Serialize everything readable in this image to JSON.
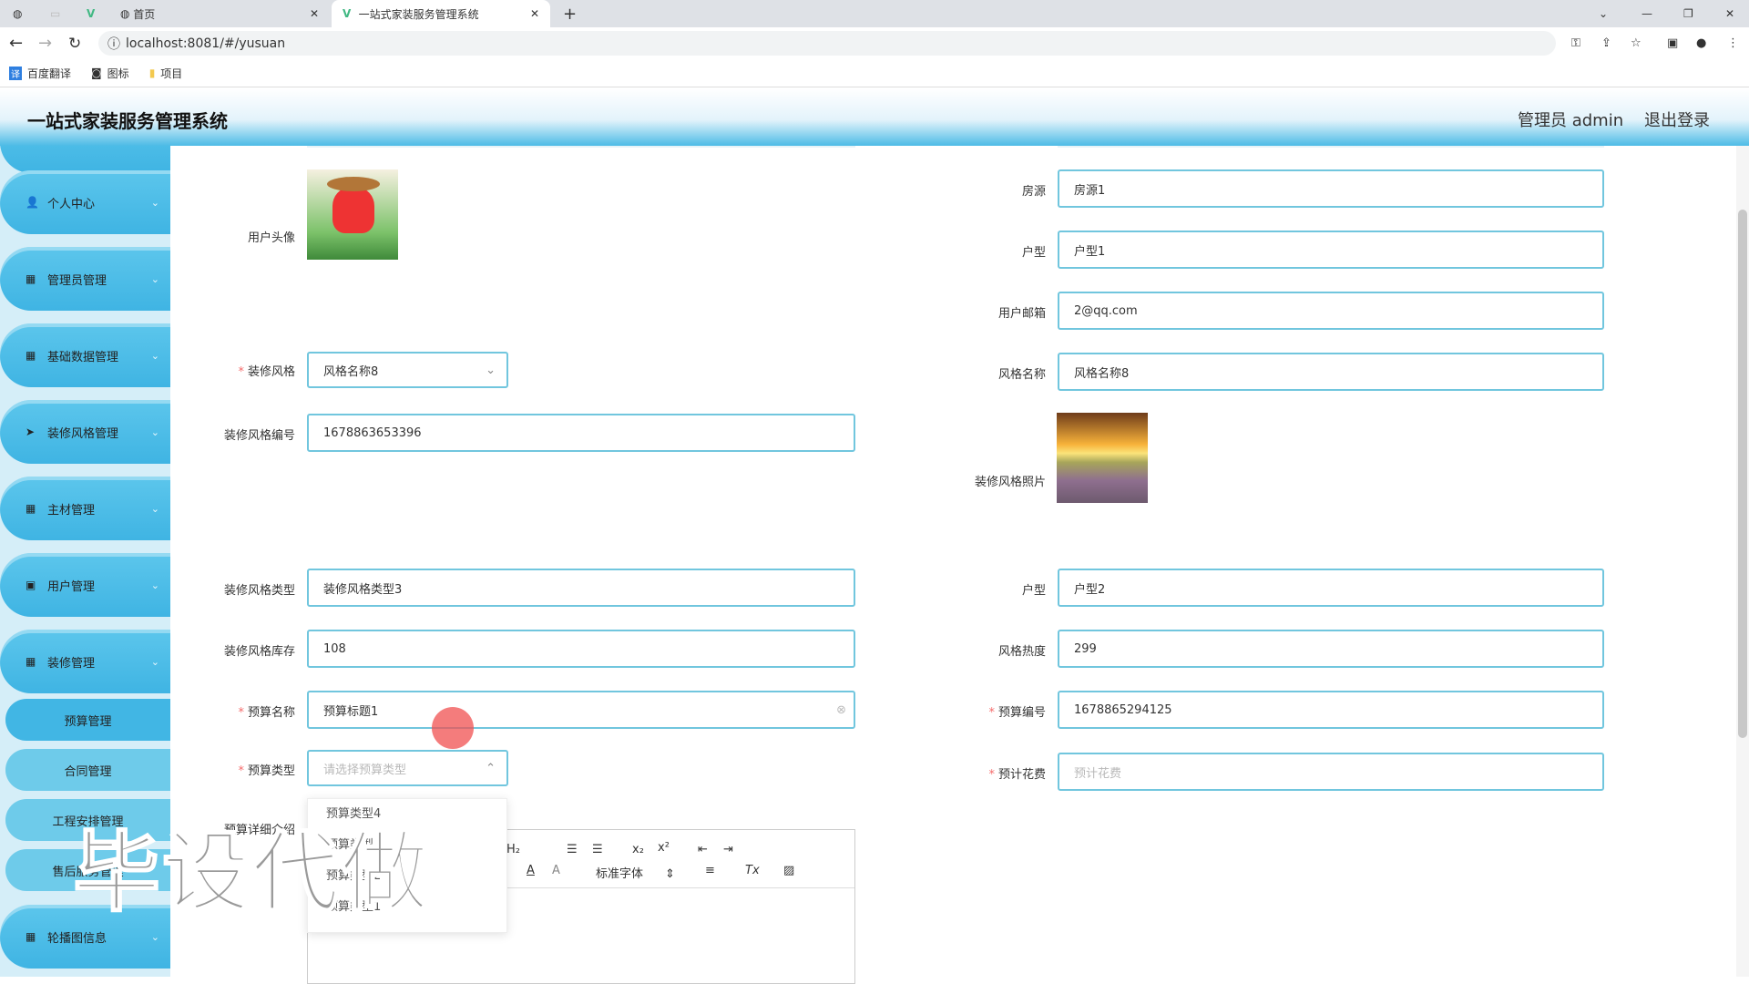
{
  "browser": {
    "tabs": [
      {
        "label": "首页"
      },
      {
        "label": "一站式家装服务管理系统"
      }
    ],
    "url": "localhost:8081/#/yusuan",
    "bookmarks": [
      "百度翻译",
      "图标",
      "项目"
    ]
  },
  "header": {
    "title": "一站式家装服务管理系统",
    "user": "管理员 admin",
    "logout": "退出登录"
  },
  "sidebar": {
    "items": [
      "个人中心",
      "管理员管理",
      "基础数据管理",
      "装修风格管理",
      "主材管理",
      "用户管理",
      "装修管理"
    ],
    "subitems": [
      "预算管理",
      "合同管理",
      "工程安排管理",
      "售后服务管理"
    ],
    "last": "轮播图信息"
  },
  "form": {
    "avatar_label": "用户头像",
    "fangyuan_label": "房源",
    "fangyuan": "房源1",
    "huxing_label": "户型",
    "huxing": "户型1",
    "email_label": "用户邮箱",
    "email": "2@qq.com",
    "style_label": "装修风格",
    "style": "风格名称8",
    "style_name_label": "风格名称",
    "style_name": "风格名称8",
    "style_no_label": "装修风格编号",
    "style_no": "1678863653396",
    "style_photo_label": "装修风格照片",
    "style_type_label": "装修风格类型",
    "style_type": "装修风格类型3",
    "huxing2_label": "户型",
    "huxing2": "户型2",
    "stock_label": "装修风格库存",
    "stock": "108",
    "heat_label": "风格热度",
    "heat": "299",
    "budget_name_label": "预算名称",
    "budget_name": "预算标题1",
    "budget_no_label": "预算编号",
    "budget_no": "1678865294125",
    "budget_type_label": "预算类型",
    "budget_type_placeholder": "请选择预算类型",
    "cost_label": "预计花费",
    "cost_placeholder": "预计花费",
    "detail_label": "预算详细介绍",
    "budget_type_options": [
      "预算类型4",
      "预算类型3",
      "预算类型2",
      "预算类型1"
    ],
    "editor_font": "标准字体"
  },
  "watermark": "毕设代做"
}
